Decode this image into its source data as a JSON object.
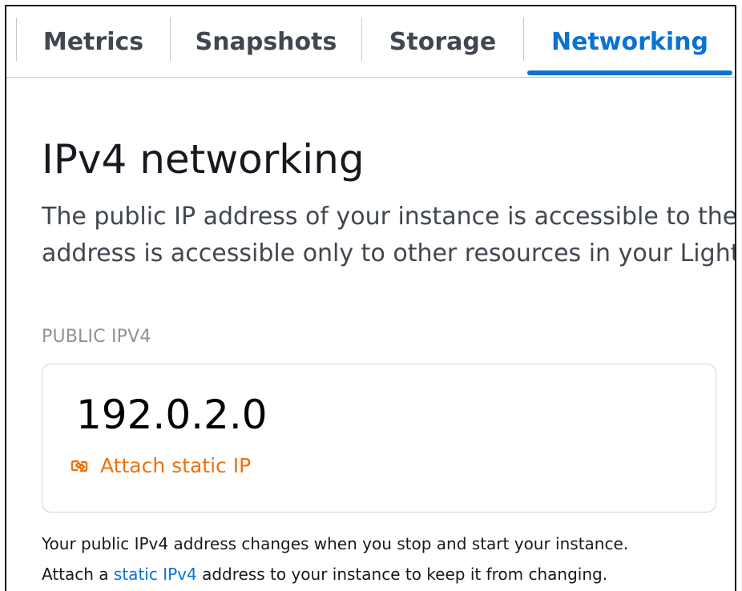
{
  "tabs": [
    {
      "label": "Metrics"
    },
    {
      "label": "Snapshots"
    },
    {
      "label": "Storage"
    },
    {
      "label": "Networking",
      "active": true
    }
  ],
  "section": {
    "title": "IPv4 networking",
    "description_line1": "The public IP address of your instance is accessible to the int",
    "description_line2": "address is accessible only to other resources in your Lightsail"
  },
  "public_ipv4": {
    "label": "PUBLIC IPV4",
    "value": "192.0.2.0",
    "attach_label": "Attach static IP",
    "attach_icon": "static-ip-link-icon"
  },
  "help": {
    "line1": "Your public IPv4 address changes when you stop and start your instance.",
    "line2_prefix": "Attach a ",
    "line2_link": "static IPv4",
    "line2_suffix": " address to your instance to keep it from changing."
  },
  "colors": {
    "accent": "#0972d3",
    "orange": "#ec7211",
    "border": "#c6c6cd"
  }
}
